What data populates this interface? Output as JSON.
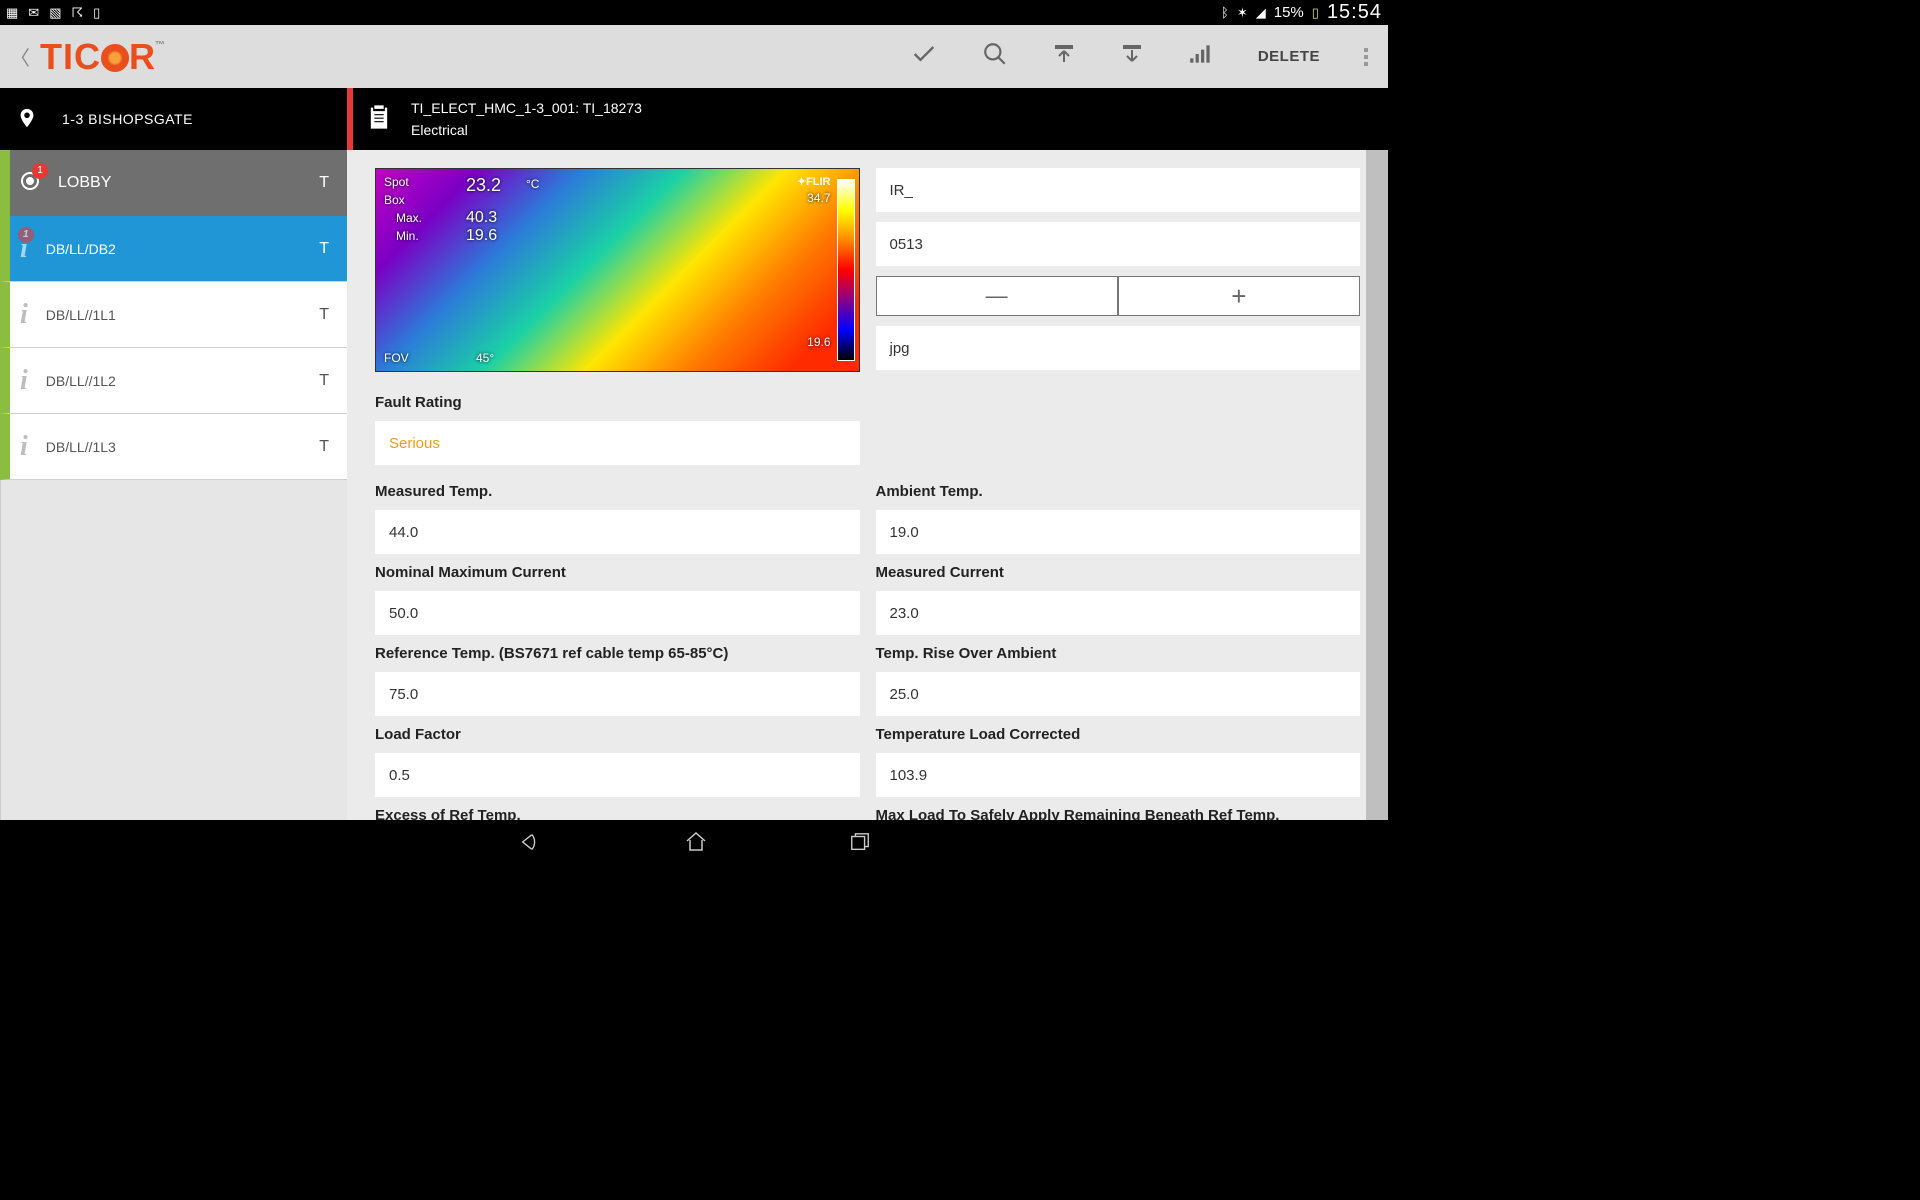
{
  "status": {
    "battery": "15%",
    "time": "15:54",
    "badge": "1"
  },
  "brand": "TICOR",
  "actions": {
    "delete": "DELETE"
  },
  "location": {
    "name": "1-3 BISHOPSGATE"
  },
  "lobby": {
    "label": "LOBBY",
    "type": "T"
  },
  "items": [
    {
      "label": "DB/LL/DB2",
      "type": "T",
      "badge": "1",
      "active": true
    },
    {
      "label": "DB/LL//1L1",
      "type": "T"
    },
    {
      "label": "DB/LL//1L2",
      "type": "T"
    },
    {
      "label": "DB/LL//1L3",
      "type": "T"
    }
  ],
  "record": {
    "title": "TI_ELECT_HMC_1-3_001: TI_18273",
    "category": "Electrical"
  },
  "thermal": {
    "spot": "Spot",
    "box": "Box",
    "maxLabel": "Max.",
    "minLabel": "Min.",
    "spotVal": "23.2",
    "maxVal": "40.3",
    "minVal": "19.6",
    "unit": "°C",
    "scaleTop": "34.7",
    "scaleBot": "19.6",
    "fov": "FOV",
    "fovVal": "45°",
    "flir": "✦FLIR"
  },
  "inputs": {
    "prefix": "IR_",
    "number": "0513",
    "ext": "jpg"
  },
  "labels": {
    "faultRating": "Fault Rating",
    "measuredTemp": "Measured Temp.",
    "ambientTemp": "Ambient Temp.",
    "nomMaxCurrent": "Nominal Maximum Current",
    "measuredCurrent": "Measured Current",
    "refTemp": "Reference Temp. (BS7671 ref cable temp 65-85°C)",
    "riseOverAmbient": "Temp. Rise Over Ambient",
    "loadFactor": "Load Factor",
    "tempLoadCorrected": "Temperature Load Corrected",
    "excessRef": "Excess of Ref Temp.",
    "maxLoadSafe": "Max Load To Safely Apply Remaining Beneath Ref Temp."
  },
  "values": {
    "faultRating": "Serious",
    "measuredTemp": "44.0",
    "ambientTemp": "19.0",
    "nomMaxCurrent": "50.0",
    "measuredCurrent": "23.0",
    "refTemp": "75.0",
    "riseOverAmbient": "25.0",
    "loadFactor": "0.5",
    "tempLoadCorrected": "103.9"
  },
  "stepper": {
    "minus": "—",
    "plus": "+"
  }
}
